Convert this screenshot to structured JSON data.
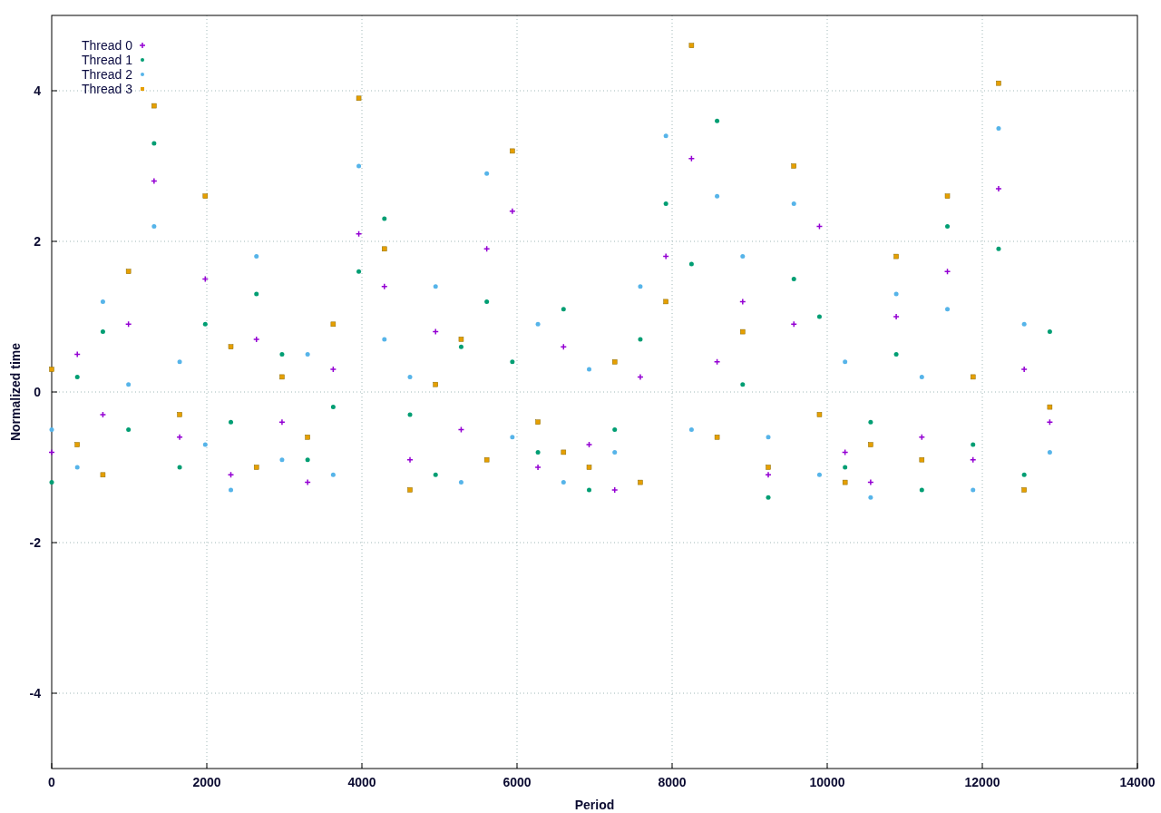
{
  "chart": {
    "chart_data": {
      "type": "scatter",
      "grid": true,
      "legend": true,
      "xlabel": "Period",
      "ylabel": "Normalized time",
      "xlim": [
        0,
        14000
      ],
      "ylim": [
        -5,
        5
      ],
      "xticks": [
        0,
        2000,
        4000,
        6000,
        8000,
        10000,
        12000,
        14000
      ],
      "yticks": [
        -4,
        -2,
        0,
        2,
        4
      ],
      "x": [
        0,
        330,
        660,
        990,
        1320,
        1650,
        1980,
        2310,
        2640,
        2970,
        3300,
        3630,
        3960,
        4290,
        4620,
        4950,
        5280,
        5610,
        5940,
        6270,
        6600,
        6930,
        7260,
        7590,
        7920,
        8250,
        8580,
        8910,
        9240,
        9570,
        9900,
        10230,
        10560,
        10890,
        11220,
        11550,
        11880,
        12210,
        12540,
        12870
      ],
      "series": [
        {
          "name": "Thread 0",
          "color": "#9400d3",
          "values": [
            -0.8,
            0.5,
            -0.3,
            0.9,
            2.8,
            -0.6,
            1.5,
            -1.1,
            0.7,
            -0.4,
            -1.2,
            0.3,
            2.1,
            1.4,
            -0.9,
            0.8,
            -0.5,
            1.9,
            2.4,
            -1.0,
            0.6,
            -0.7,
            -1.3,
            0.2,
            1.8,
            3.1,
            0.4,
            1.2,
            -1.1,
            0.9,
            2.2,
            -0.8,
            -1.2,
            1.0,
            -0.6,
            1.6,
            -0.9,
            2.7,
            0.3,
            -0.4
          ]
        },
        {
          "name": "Thread 1",
          "color": "#009e73",
          "values": [
            -1.2,
            0.2,
            0.8,
            -0.5,
            3.3,
            -1.0,
            0.9,
            -0.4,
            1.3,
            0.5,
            -0.9,
            -0.2,
            1.6,
            2.3,
            -0.3,
            -1.1,
            0.6,
            1.2,
            0.4,
            -0.8,
            1.1,
            -1.3,
            -0.5,
            0.7,
            2.5,
            1.7,
            3.6,
            0.1,
            -1.4,
            1.5,
            1.0,
            -1.0,
            -0.4,
            0.5,
            -1.3,
            2.2,
            -0.7,
            1.9,
            -1.1,
            0.8
          ]
        },
        {
          "name": "Thread 2",
          "color": "#56b4e9",
          "values": [
            -0.5,
            -1.0,
            1.2,
            0.1,
            2.2,
            0.4,
            -0.7,
            -1.3,
            1.8,
            -0.9,
            0.5,
            -1.1,
            3.0,
            0.7,
            0.2,
            1.4,
            -1.2,
            2.9,
            -0.6,
            0.9,
            -1.2,
            0.3,
            -0.8,
            1.4,
            3.4,
            -0.5,
            2.6,
            1.8,
            -0.6,
            2.5,
            -1.1,
            0.4,
            -1.4,
            1.3,
            0.2,
            1.1,
            -1.3,
            3.5,
            0.9,
            -0.8
          ]
        },
        {
          "name": "Thread 3",
          "color": "#e69f00",
          "values": [
            0.3,
            -0.7,
            -1.1,
            1.6,
            3.8,
            -0.3,
            2.6,
            0.6,
            -1.0,
            0.2,
            -0.6,
            0.9,
            3.9,
            1.9,
            -1.3,
            0.1,
            0.7,
            -0.9,
            3.2,
            -0.4,
            -0.8,
            -1.0,
            0.4,
            -1.2,
            1.2,
            4.6,
            -0.6,
            0.8,
            -1.0,
            3.0,
            -0.3,
            -1.2,
            -0.7,
            1.8,
            -0.9,
            2.6,
            0.2,
            4.1,
            -1.3,
            -0.2
          ]
        }
      ]
    }
  }
}
